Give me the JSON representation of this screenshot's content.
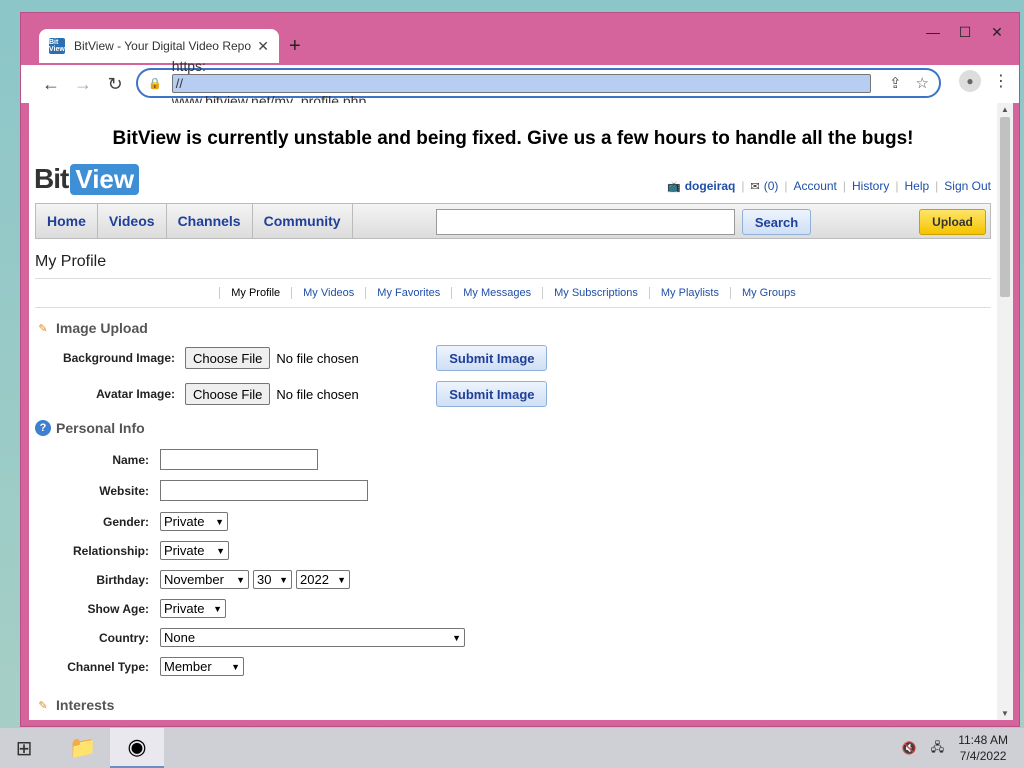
{
  "browser": {
    "tab_title": "BitView - Your Digital Video Repo",
    "favicon_text": "Bit View",
    "url_prefix": "https:",
    "url_selected": "//",
    "url_rest": "www.bitview.net/my_profile.php"
  },
  "site": {
    "banner": "BitView is currently unstable and being fixed. Give us a few hours to handle all the bugs!",
    "logo_bit": "Bit",
    "logo_view": "View",
    "user": {
      "username": "dogeiraq",
      "messages": "(0)",
      "links": [
        "Account",
        "History",
        "Help",
        "Sign Out"
      ]
    },
    "nav": [
      "Home",
      "Videos",
      "Channels",
      "Community"
    ],
    "search_button": "Search",
    "search_value": "",
    "upload_button": "Upload"
  },
  "page": {
    "title": "My Profile",
    "subnav": [
      "My Profile",
      "My Videos",
      "My Favorites",
      "My Messages",
      "My Subscriptions",
      "My Playlists",
      "My Groups"
    ],
    "active_subnav": "My Profile"
  },
  "image_upload": {
    "heading": "Image Upload",
    "rows": [
      {
        "label": "Background Image:",
        "choose": "Choose File",
        "status": "No file chosen",
        "submit": "Submit Image"
      },
      {
        "label": "Avatar Image:",
        "choose": "Choose File",
        "status": "No file chosen",
        "submit": "Submit Image"
      }
    ]
  },
  "personal_info": {
    "heading": "Personal Info",
    "name_label": "Name:",
    "name_value": "",
    "website_label": "Website:",
    "website_value": "",
    "gender_label": "Gender:",
    "gender_value": "Private",
    "relationship_label": "Relationship:",
    "relationship_value": "Private",
    "birthday_label": "Birthday:",
    "birthday_month": "November",
    "birthday_day": "30",
    "birthday_year": "2022",
    "show_age_label": "Show Age:",
    "show_age_value": "Private",
    "country_label": "Country:",
    "country_value": "None",
    "channel_type_label": "Channel Type:",
    "channel_type_value": "Member"
  },
  "interests": {
    "heading": "Interests"
  },
  "taskbar": {
    "time": "11:48 AM",
    "date": "7/4/2022"
  },
  "colors": {
    "window_frame": "#d6649c",
    "link": "#1f4fa8",
    "nav_text": "#1f3f99",
    "upload_button": "#f4c400",
    "logo_view_bg": "#3e8fd6"
  }
}
